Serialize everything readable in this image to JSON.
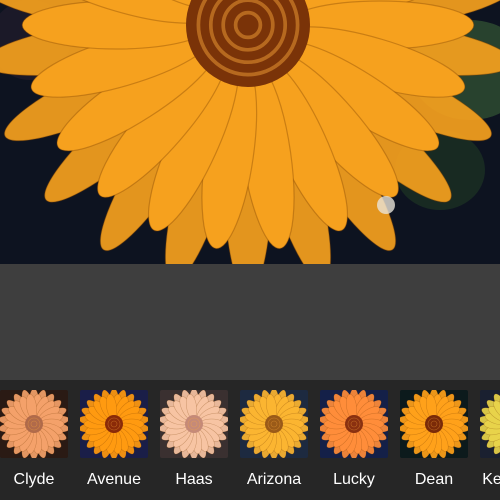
{
  "photo": {
    "subject_icon": "sunflower-photo",
    "petal_color": "#f6a11e",
    "center_color": "#7a3308",
    "background_color": "#0d1320"
  },
  "filters": [
    {
      "label": "Clyde",
      "petal": "#f4a16a",
      "center": "#b06a4a",
      "bg": "#2a1a14"
    },
    {
      "label": "Avenue",
      "petal": "#ff9a10",
      "center": "#8a2a08",
      "bg": "#1a1e48"
    },
    {
      "label": "Haas",
      "petal": "#f7c4a3",
      "center": "#c58a78",
      "bg": "#3a3030"
    },
    {
      "label": "Arizona",
      "petal": "#fbb531",
      "center": "#9a5a18",
      "bg": "#1d2a40"
    },
    {
      "label": "Lucky",
      "petal": "#ff8d3a",
      "center": "#8a3010",
      "bg": "#142048"
    },
    {
      "label": "Dean",
      "petal": "#ffa11a",
      "center": "#7a2a08",
      "bg": "#0c1a1c"
    },
    {
      "label": "Ke",
      "petal": "#e8d34a",
      "center": "#8a7a18",
      "bg": "#1a2030"
    }
  ]
}
